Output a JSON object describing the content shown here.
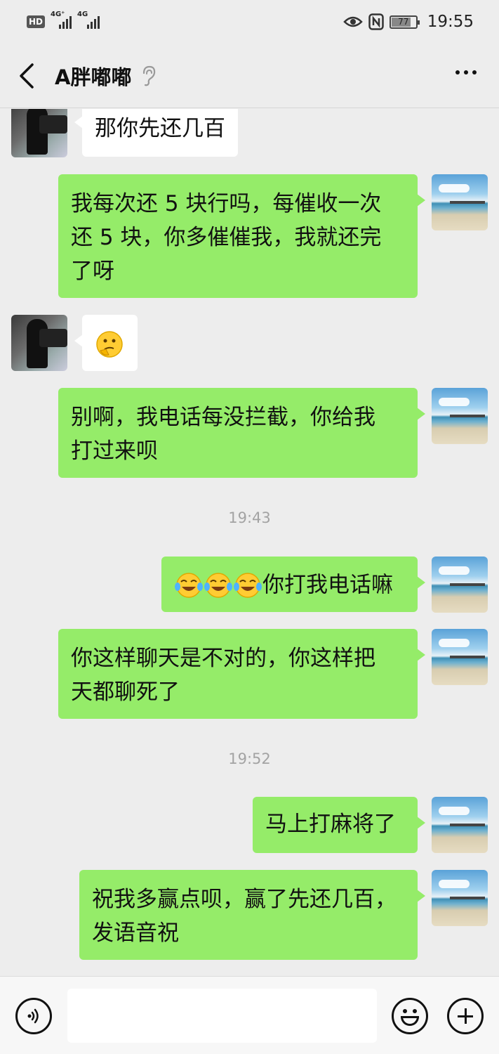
{
  "status_bar": {
    "hd": "HD",
    "sim1": "4G⁺",
    "sim2": "4G",
    "battery": "77",
    "time": "19:55"
  },
  "header": {
    "title": "A胖嘟嘟",
    "icons": [
      "back-icon",
      "ear-icon",
      "more-icon"
    ]
  },
  "messages": [
    {
      "from": "friend",
      "text": "那你先还几百"
    },
    {
      "from": "me",
      "lines": [
        "我每次还 5 块行吗，每催收一次",
        "还 5 块，你多催催我，我就还完",
        "了呀"
      ]
    },
    {
      "from": "friend",
      "emoji": "thinking-face"
    },
    {
      "from": "me",
      "lines": [
        "别啊，我电话每没拦截，你给我",
        "打过来呗"
      ]
    },
    {
      "timestamp": "19:43"
    },
    {
      "from": "me",
      "text": "你打我电话嘛",
      "emoji_prefix": "tears-of-joy x3"
    },
    {
      "from": "me",
      "lines": [
        "你这样聊天是不对的，你这样把",
        "天都聊死了"
      ]
    },
    {
      "timestamp": "19:52"
    },
    {
      "from": "me",
      "text": "马上打麻将了"
    },
    {
      "from": "me",
      "lines": [
        "祝我多赢点呗，赢了先还几百，",
        "发语音祝"
      ]
    }
  ],
  "input_bar": {
    "placeholder": "",
    "icons": [
      "voice-icon",
      "emoji-icon",
      "plus-icon"
    ]
  },
  "colors": {
    "background": "#ededed",
    "outgoing_bubble": "#95ec69",
    "incoming_bubble": "#ffffff",
    "timestamp": "#a3a3a3"
  }
}
